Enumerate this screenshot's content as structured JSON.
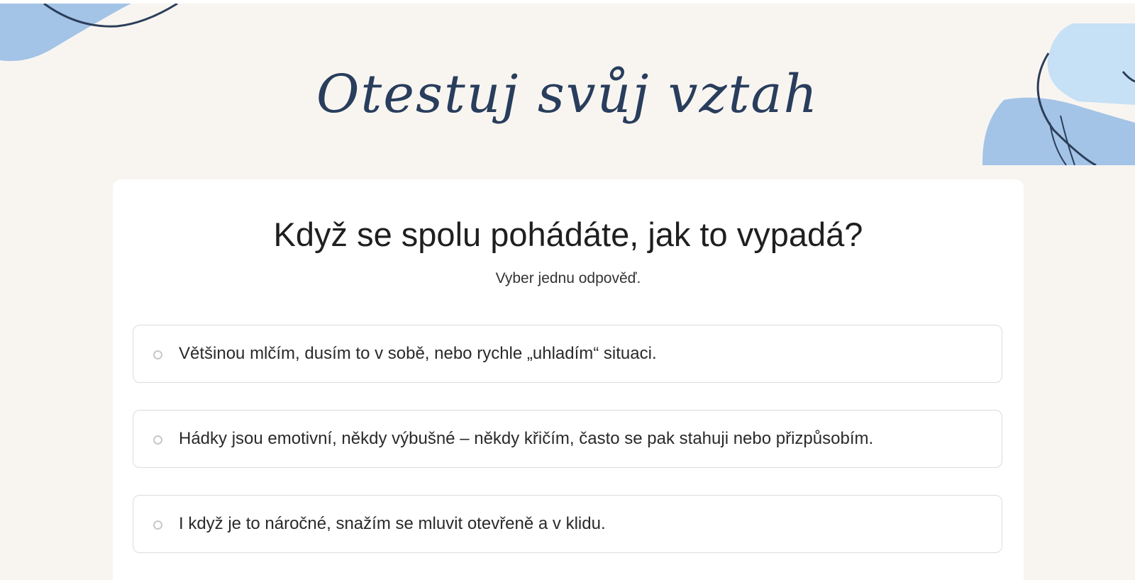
{
  "header": {
    "title": "Otestuj svůj vztah"
  },
  "quiz": {
    "question": "Když se spolu pohádáte, jak to vypadá?",
    "hint": "Vyber jednu odpověď.",
    "options": [
      {
        "label": "Většinou mlčím, dusím to v sobě, nebo rychle „uhladím“ situaci.",
        "selected": false
      },
      {
        "label": "Hádky jsou emotivní, někdy výbušné – někdy křičím, často se pak stahuji nebo přizpůsobím.",
        "selected": false
      },
      {
        "label": "I když je to náročné, snažím se mluvit otevřeně a v klidu.",
        "selected": false
      }
    ]
  },
  "colors": {
    "background": "#f8f5f1",
    "card": "#ffffff",
    "title": "#293d5c",
    "accent_light_blue": "#a3c4e6",
    "accent_pale_blue": "#c6e0f5",
    "line_navy": "#2c3e5a"
  }
}
